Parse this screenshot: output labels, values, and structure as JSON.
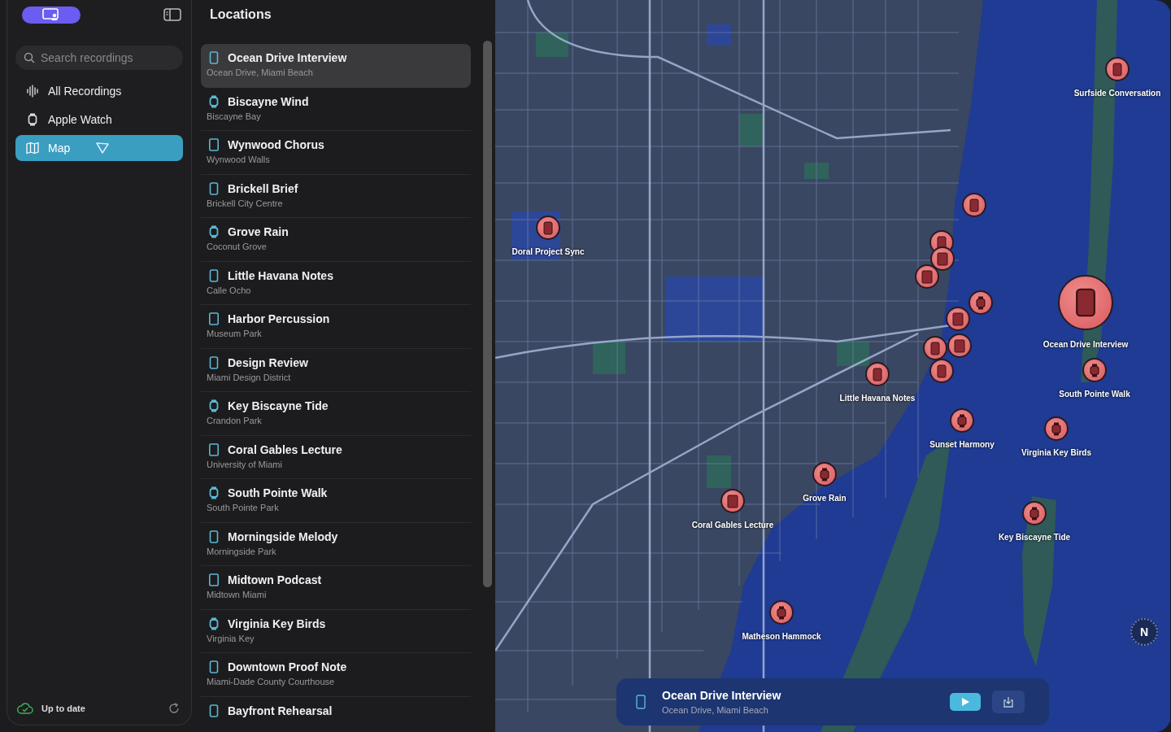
{
  "sidebar": {
    "search": {
      "placeholder": "Search recordings"
    },
    "items": [
      {
        "label": "All Recordings",
        "kind": "waveform",
        "selected": false
      },
      {
        "label": "Apple Watch",
        "kind": "watch",
        "selected": false
      },
      {
        "label": "Map",
        "kind": "map",
        "selected": true
      }
    ],
    "status": "Up to date"
  },
  "list": {
    "title": "Locations",
    "items": [
      {
        "title": "Ocean Drive Interview",
        "location": "Ocean Drive, Miami Beach",
        "kind": "phone",
        "selected": true
      },
      {
        "title": "Biscayne Wind",
        "location": "Biscayne Bay",
        "kind": "watch",
        "selected": false
      },
      {
        "title": "Wynwood Chorus",
        "location": "Wynwood Walls",
        "kind": "tablet",
        "selected": false
      },
      {
        "title": "Brickell Brief",
        "location": "Brickell City Centre",
        "kind": "phone",
        "selected": false
      },
      {
        "title": "Grove Rain",
        "location": "Coconut Grove",
        "kind": "watch",
        "selected": false
      },
      {
        "title": "Little Havana Notes",
        "location": "Calle Ocho",
        "kind": "phone",
        "selected": false
      },
      {
        "title": "Harbor Percussion",
        "location": "Museum Park",
        "kind": "tablet",
        "selected": false
      },
      {
        "title": "Design Review",
        "location": "Miami Design District",
        "kind": "phone",
        "selected": false
      },
      {
        "title": "Key Biscayne Tide",
        "location": "Crandon Park",
        "kind": "watch",
        "selected": false
      },
      {
        "title": "Coral Gables Lecture",
        "location": "University of Miami",
        "kind": "tablet",
        "selected": false
      },
      {
        "title": "South Pointe Walk",
        "location": "South Pointe Park",
        "kind": "watch",
        "selected": false
      },
      {
        "title": "Morningside Melody",
        "location": "Morningside Park",
        "kind": "phone",
        "selected": false
      },
      {
        "title": "Midtown Podcast",
        "location": "Midtown Miami",
        "kind": "tablet",
        "selected": false
      },
      {
        "title": "Virginia Key Birds",
        "location": "Virginia Key",
        "kind": "watch",
        "selected": false
      },
      {
        "title": "Downtown Proof Note",
        "location": "Miami-Dade County Courthouse",
        "kind": "phone",
        "selected": false
      },
      {
        "title": "Bayfront Rehearsal",
        "kind": "phone",
        "selected": false
      }
    ]
  },
  "map": {
    "pins": [
      {
        "label": "Surfside Conversation",
        "kind": "phone",
        "selected": false
      },
      {
        "label": "Doral Project Sync",
        "kind": "phone",
        "selected": false
      },
      {
        "kind": "phone",
        "selected": false
      },
      {
        "kind": "phone",
        "selected": false
      },
      {
        "kind": "tablet",
        "selected": false
      },
      {
        "kind": "tablet",
        "selected": false
      },
      {
        "label": "Ocean Drive Interview",
        "kind": "phone",
        "selected": true
      },
      {
        "kind": "watch",
        "selected": false
      },
      {
        "kind": "tablet",
        "selected": false
      },
      {
        "kind": "tablet",
        "selected": false
      },
      {
        "kind": "phone",
        "selected": false
      },
      {
        "label": "South Pointe Walk",
        "kind": "watch",
        "selected": false
      },
      {
        "kind": "phone",
        "selected": false
      },
      {
        "label": "Little Havana Notes",
        "kind": "phone",
        "selected": false
      },
      {
        "label": "Sunset Harmony",
        "kind": "watch",
        "selected": false
      },
      {
        "label": "Virginia Key Birds",
        "kind": "watch",
        "selected": false
      },
      {
        "label": "Grove Rain",
        "kind": "watch",
        "selected": false
      },
      {
        "label": "Coral Gables Lecture",
        "kind": "tablet",
        "selected": false
      },
      {
        "label": "Key Biscayne Tide",
        "kind": "watch",
        "selected": false
      },
      {
        "label": "Matheson Hammock",
        "kind": "watch",
        "selected": false
      }
    ],
    "compass": "N"
  },
  "player": {
    "title": "Ocean Drive Interview",
    "location": "Ocean Drive, Miami Beach",
    "kind": "phone"
  }
}
